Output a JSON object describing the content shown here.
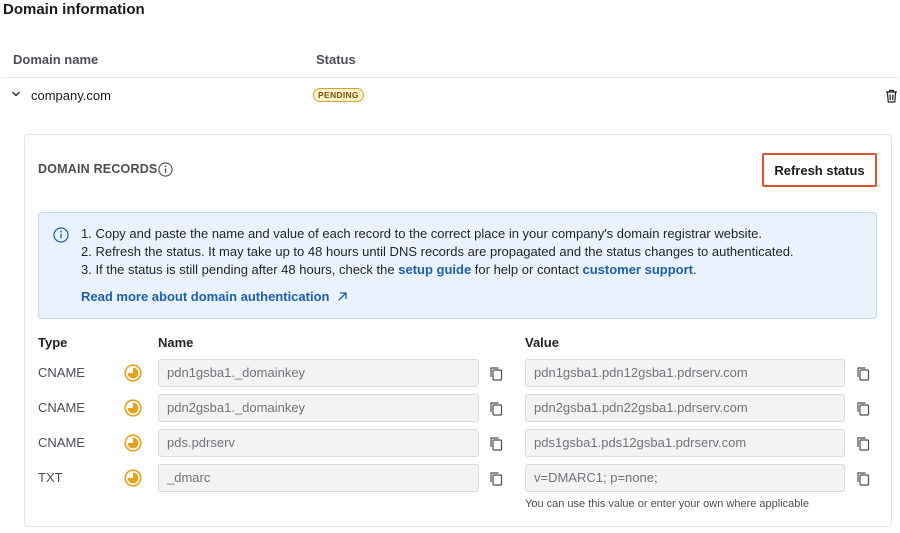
{
  "page": {
    "title": "Domain information"
  },
  "table": {
    "headers": {
      "name": "Domain name",
      "status": "Status"
    },
    "row": {
      "domain": "company.com",
      "status": "PENDING"
    }
  },
  "card": {
    "title": "DOMAIN RECORDS",
    "refresh_label": "Refresh status",
    "notice": {
      "line1": "1. Copy and paste the name and value of each record to the correct place in your company's domain registrar website.",
      "line2": "2. Refresh the status. It may take up to 48 hours until DNS records are propagated and the status changes to authenticated.",
      "line3_prefix": "3. If the status is still pending after 48 hours, check the ",
      "line3_link1": "setup guide",
      "line3_middle": " for help or contact ",
      "line3_link2": "customer support",
      "line3_suffix": ".",
      "read_more": "Read more about domain authentication"
    },
    "columns": {
      "type": "Type",
      "name": "Name",
      "value": "Value"
    },
    "records": [
      {
        "type": "CNAME",
        "name": "pdn1gsba1._domainkey",
        "value": "pdn1gsba1.pdn12gsba1.pdrserv.com"
      },
      {
        "type": "CNAME",
        "name": "pdn2gsba1._domainkey",
        "value": "pdn2gsba1.pdn22gsba1.pdrserv.com"
      },
      {
        "type": "CNAME",
        "name": "pds.pdrserv",
        "value": "pds1gsba1.pds12gsba1.pdrserv.com"
      },
      {
        "type": "TXT",
        "name": "_dmarc",
        "value": "v=DMARC1; p=none;"
      }
    ],
    "helper_text": "You can use this value or enter your own where applicable"
  },
  "icons": {
    "chevron": "chevron-down-icon",
    "trash": "trash-icon",
    "info": "info-icon",
    "pending": "pending-status-icon",
    "copy": "copy-icon",
    "external": "external-link-icon"
  },
  "colors": {
    "accent_border": "#e2512d",
    "link": "#1c5fae",
    "pending_icon": "#e5a21a",
    "notice_bg": "#eaf3fd"
  }
}
